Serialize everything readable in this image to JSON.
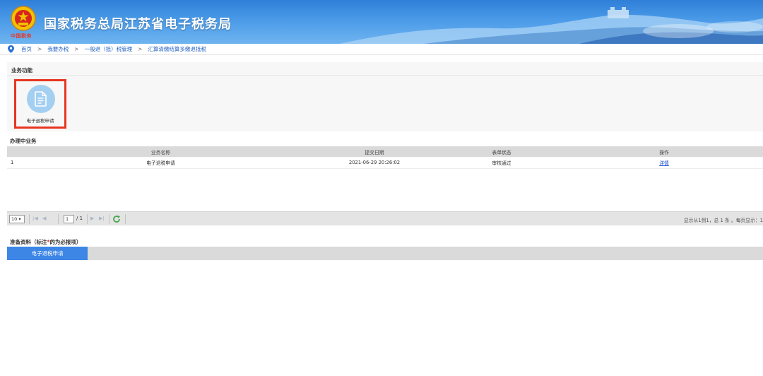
{
  "header": {
    "site_title": "国家税务总局江苏省电子税务局",
    "emblem_subtitle": "中国税务",
    "brand_color": "#2f7fd8"
  },
  "breadcrumb": {
    "items": [
      "首页",
      "我要办税",
      "一般退（抵）税管理",
      "汇算清缴结算多缴退抵税"
    ],
    "separator": ">",
    "icon": "location-pin-icon"
  },
  "business_functions": {
    "title": "业务功能",
    "items": [
      {
        "label": "电子退税申请",
        "icon": "document-icon",
        "highlight_color": "#e8351f"
      }
    ]
  },
  "in_progress": {
    "title": "办理中业务",
    "columns": [
      "业务名称",
      "提交日期",
      "表单状态",
      "操作"
    ],
    "rows": [
      {
        "index": "1",
        "name": "电子退税申请",
        "date": "2021-06-29 20:26:02",
        "status": "审核通过",
        "action": "详情"
      }
    ]
  },
  "pager": {
    "page_size": "10",
    "current_page": "1",
    "total_pages": "/ 1",
    "info": "显示从1到1，总 1 条 。每页显示：1"
  },
  "prep_materials": {
    "title_prefix": "准备资料（标注",
    "required_mark": "*",
    "title_suffix": "的为必报项）",
    "active_tab": "电子退税申请",
    "tab_color": "#3d86e6"
  }
}
